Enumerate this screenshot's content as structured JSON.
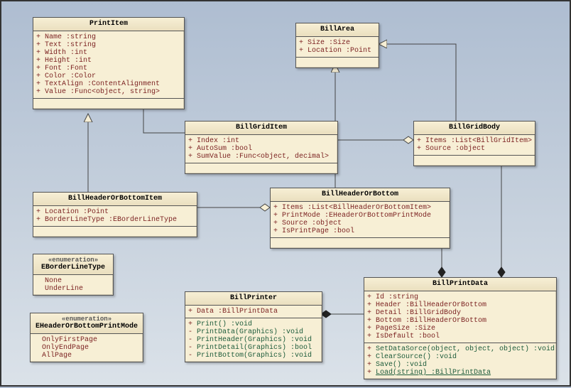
{
  "classes": {
    "PrintItem": {
      "title": "PrintItem",
      "attrs": [
        {
          "v": "+",
          "t": "Name  :string"
        },
        {
          "v": "+",
          "t": "Text  :string"
        },
        {
          "v": "+",
          "t": "Width  :int"
        },
        {
          "v": "+",
          "t": "Height  :int"
        },
        {
          "v": "+",
          "t": "Font  :Font"
        },
        {
          "v": "+",
          "t": "Color  :Color"
        },
        {
          "v": "+",
          "t": "TextAlign  :ContentAlignment"
        },
        {
          "v": "+",
          "t": "Value  :Func<object, string>"
        }
      ]
    },
    "BillArea": {
      "title": "BillArea",
      "attrs": [
        {
          "v": "+",
          "t": "Size  :Size"
        },
        {
          "v": "+",
          "t": "Location  :Point"
        }
      ]
    },
    "BillGridItem": {
      "title": "BillGridItem",
      "attrs": [
        {
          "v": "+",
          "t": "Index  :int"
        },
        {
          "v": "+",
          "t": "AutoSum  :bool"
        },
        {
          "v": "+",
          "t": "SumValue  :Func<object, decimal>"
        }
      ]
    },
    "BillGridBody": {
      "title": "BillGridBody",
      "attrs": [
        {
          "v": "+",
          "t": "Items  :List<BillGridItem>"
        },
        {
          "v": "+",
          "t": "Source  :object"
        }
      ]
    },
    "BillHeaderOrBottomItem": {
      "title": "BillHeaderOrBottomItem",
      "attrs": [
        {
          "v": "+",
          "t": "Location  :Point"
        },
        {
          "v": "+",
          "t": "BorderLineType  :EBorderLineType"
        }
      ]
    },
    "BillHeaderOrBottom": {
      "title": "BillHeaderOrBottom",
      "attrs": [
        {
          "v": "+",
          "t": "Items  :List<BillHeaderOrBottomItem>"
        },
        {
          "v": "+",
          "t": "PrintMode  :EHeaderOrBottomPrintMode"
        },
        {
          "v": "+",
          "t": "Source  :object"
        },
        {
          "v": "+",
          "t": "IsPrintPage  :bool"
        }
      ]
    },
    "EBorderLineType": {
      "stereo": "«enumeration»",
      "title": "EBorderLineType",
      "lits": [
        "None",
        "UnderLine"
      ]
    },
    "EHeaderOrBottomPrintMode": {
      "stereo": "«enumeration»",
      "title": "EHeaderOrBottomPrintMode",
      "lits": [
        "OnlyFirstPage",
        "OnlyEndPage",
        "AllPage"
      ]
    },
    "BillPrinter": {
      "title": "BillPrinter",
      "attrs": [
        {
          "v": "+",
          "t": "Data  :BillPrintData"
        }
      ],
      "ops": [
        {
          "v": "+",
          "t": "Print()  :void"
        },
        {
          "v": "-",
          "t": "PrintData(Graphics)  :void"
        },
        {
          "v": "-",
          "t": "PrintHeader(Graphics)  :void"
        },
        {
          "v": "-",
          "t": "PrintDetail(Graphics)  :bool"
        },
        {
          "v": "-",
          "t": "PrintBottom(Graphics)  :void"
        }
      ]
    },
    "BillPrintData": {
      "title": "BillPrintData",
      "attrs": [
        {
          "v": "+",
          "t": "Id  :string"
        },
        {
          "v": "+",
          "t": "Header  :BillHeaderOrBottom"
        },
        {
          "v": "+",
          "t": "Detail  :BillGridBody"
        },
        {
          "v": "+",
          "t": "Bottom  :BillHeaderOrBottom"
        },
        {
          "v": "+",
          "t": "PageSize  :Size"
        },
        {
          "v": "+",
          "t": "IsDefault  :bool"
        }
      ],
      "ops": [
        {
          "v": "+",
          "t": "SetDataSorce(object, object, object)  :void"
        },
        {
          "v": "+",
          "t": "ClearSource()  :void"
        },
        {
          "v": "+",
          "t": "Save()  :void"
        },
        {
          "v": "+",
          "t": "Load(string)  :BillPrintData",
          "u": true
        }
      ]
    }
  }
}
